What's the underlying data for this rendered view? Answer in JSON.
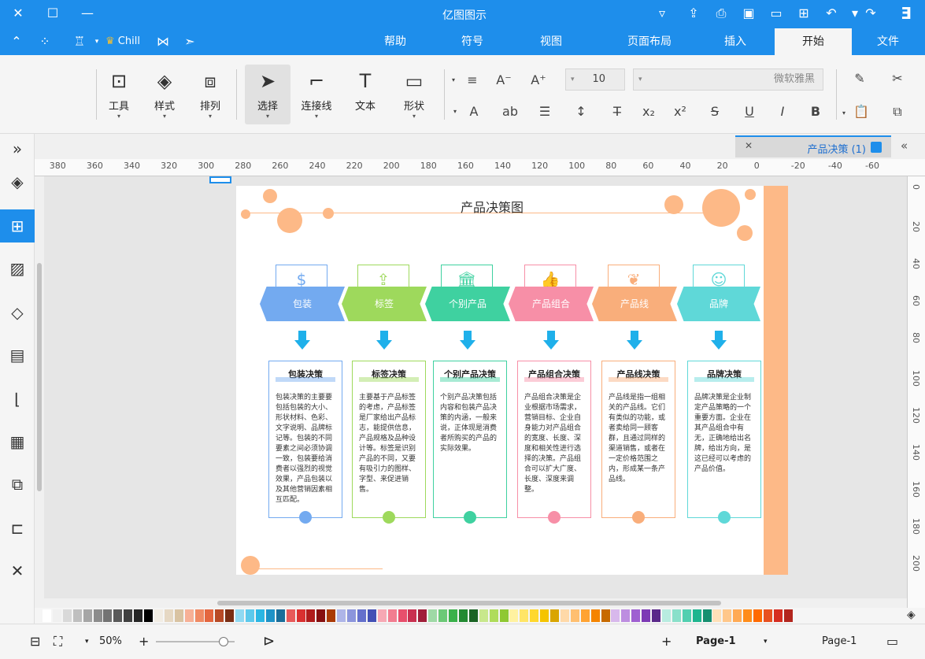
{
  "app": {
    "title": "亿图图示"
  },
  "ribbon_tabs": [
    {
      "label": "文件"
    },
    {
      "label": "开始",
      "active": true
    },
    {
      "label": "插入"
    },
    {
      "label": "页面布局"
    },
    {
      "label": "视图"
    },
    {
      "label": "符号"
    },
    {
      "label": "帮助"
    }
  ],
  "user": {
    "name": "Chill"
  },
  "toolbar": {
    "font_name": "微软雅黑",
    "font_size": "10",
    "big_buttons": [
      {
        "label": "形状"
      },
      {
        "label": "文本"
      },
      {
        "label": "连接线"
      },
      {
        "label": "选择"
      },
      {
        "label": "排列"
      },
      {
        "label": "样式"
      },
      {
        "label": "工具"
      }
    ]
  },
  "document": {
    "tab_title": "产品决策 (1)"
  },
  "ruler": {
    "h_ticks": [
      "-60",
      "-40",
      "-20",
      "0",
      "20",
      "40",
      "60",
      "80",
      "100",
      "120",
      "140",
      "160",
      "180",
      "200",
      "220",
      "240",
      "260",
      "280",
      "300",
      "320",
      "340",
      "360",
      "380"
    ],
    "v_ticks": [
      "0",
      "20",
      "40",
      "60",
      "80",
      "100",
      "120",
      "140",
      "160",
      "180",
      "200"
    ]
  },
  "diagram": {
    "title": "产品决策图",
    "columns": [
      {
        "head": "品牌",
        "card_title": "品牌决策",
        "color": "#5fd8d8",
        "text": "品牌决策是企业制定产品策略的一个重要方面。企业在其产品组合中有无，正确地给出名牌，给出方向，是这已经可以考虑的产品价值。"
      },
      {
        "head": "产品线",
        "card_title": "产品线决策",
        "color": "#f9ae7b",
        "text": "产品线是指一组相关的产品线。它们有类似的功能，或者卖给同一顾客群，且通过同样的渠道销售，或者在一定价格范围之内，形成某一条产品线。"
      },
      {
        "head": "产品组合",
        "card_title": "产品组合决策",
        "color": "#f78fa7",
        "text": "产品组合决策是企业根据市场需求，营销目标、企业自身能力对产品组合的宽度、长度、深度和相关性进行选择的决策。产品组合可以扩大广度、长度、深度来调整。"
      },
      {
        "head": "个别产品",
        "card_title": "个别产品决策",
        "color": "#3fd1a0",
        "text": "个别产品决策包括内容和包装产品决策的内涵，一般来说，正体现是消费者所购买的产品的实际效果。"
      },
      {
        "head": "标签",
        "card_title": "标签决策",
        "color": "#9ed95c",
        "text": "主要基于产品标签的考虑，产品标签是厂家给出产品标志，能提供信息，产品规格及品种设计等。标签是识别产品的不同，又要有吸引力的图样、字型、来促进销售。"
      },
      {
        "head": "包装",
        "card_title": "包装决策",
        "color": "#73aaf0",
        "text": "包装决策的主要要包括包装的大小、形状材料、色彩、文字说明、品牌标记等。包装的不同要素之间必须协调一致，包装要给消费者以强烈的视觉效果，产品包装以及其他营销因素相互匹配。"
      }
    ]
  },
  "status": {
    "page_tab": "Page-1",
    "page_current": "Page-1",
    "zoom": "50%"
  },
  "palette": [
    "#ffffff",
    "#f0f0f0",
    "#d9d9d9",
    "#bfbfbf",
    "#a6a6a6",
    "#8c8c8c",
    "#737373",
    "#595959",
    "#404040",
    "#262626",
    "#000000",
    "#f2ede4",
    "#e6d8c3",
    "#d9c3a2",
    "#f7b096",
    "#f08a64",
    "#e4663f",
    "#b84a26",
    "#7a2e14",
    "#8fd9f2",
    "#5cc9ec",
    "#2bb6e3",
    "#1e92c7",
    "#1a6e9a",
    "#e85a5a",
    "#d93030",
    "#b01c1c",
    "#861010",
    "#aa3a06",
    "#aeb5e8",
    "#8b95dc",
    "#6470cc",
    "#4350b5",
    "#f7a8b4",
    "#f27d90",
    "#e84f6c",
    "#c93050",
    "#a01f3a",
    "#9fd9a6",
    "#6cc977",
    "#3ab14a",
    "#238a32",
    "#1a6424",
    "#c8e88c",
    "#afdc5a",
    "#8fc832",
    "#fff2a0",
    "#ffe566",
    "#ffd82d",
    "#f5c400",
    "#d9a500",
    "#ffd9a8",
    "#ffbf70",
    "#ffa333",
    "#f58400",
    "#c76a00",
    "#d8b8ec",
    "#bd8ee0",
    "#9f60d1",
    "#7d3ab5",
    "#5a2889",
    "#b8ece0",
    "#8ae0ca",
    "#52cfb0",
    "#1fb58f",
    "#168f70",
    "#ffe0b8",
    "#ffc78a",
    "#ffaa55",
    "#ff8c1a",
    "#ff6a00",
    "#e85020",
    "#d62d20",
    "#b3261e"
  ]
}
